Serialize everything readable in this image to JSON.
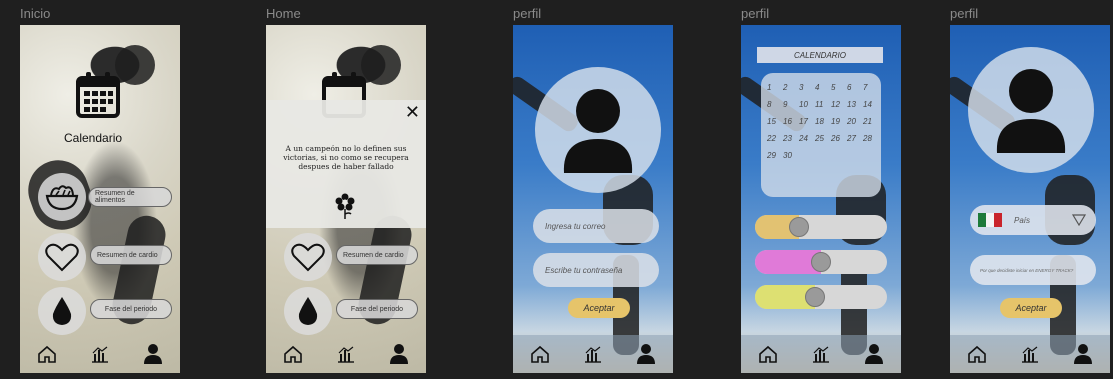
{
  "frames": [
    {
      "label": "Inicio"
    },
    {
      "label": "Home"
    },
    {
      "label": "perfil"
    },
    {
      "label": "perfil"
    },
    {
      "label": "perfil"
    }
  ],
  "inicio": {
    "calendar_label": "Calendario",
    "food_summary": "Resumen de alimentos",
    "cardio_summary": "Resumen de cardio",
    "period_phase": "Fase del periodo"
  },
  "home": {
    "quote": "A un campeón no lo definen sus victorias, si no como se recupera despues de haber fallado",
    "close": "✕",
    "cardio_summary": "Resumen de cardio",
    "period_phase": "Fase del periodo"
  },
  "perfil_login": {
    "email_placeholder": "Ingresa tu correo",
    "password_placeholder": "Escribe tu contraseña",
    "accept": "Aceptar"
  },
  "perfil_calendar": {
    "header": "CALENDARIO",
    "days": [
      "1",
      "2",
      "3",
      "4",
      "5",
      "6",
      "7",
      "8",
      "9",
      "10",
      "11",
      "12",
      "13",
      "14",
      "15",
      "16",
      "17",
      "18",
      "19",
      "20",
      "21",
      "22",
      "23",
      "24",
      "25",
      "26",
      "27",
      "28",
      "29",
      "30"
    ],
    "toggles": [
      {
        "color": "#e2c272",
        "level": 0.3
      },
      {
        "color": "#e07ad8",
        "level": 0.5
      },
      {
        "color": "#dde072",
        "level": 0.45
      }
    ]
  },
  "perfil_country": {
    "country_placeholder": "País",
    "question": "Por que decidiste iniciar en ENERGY TRACK?",
    "accept": "Aceptar"
  },
  "colors": {
    "accent": "#e6c46a",
    "background": "#1f1f1f"
  }
}
